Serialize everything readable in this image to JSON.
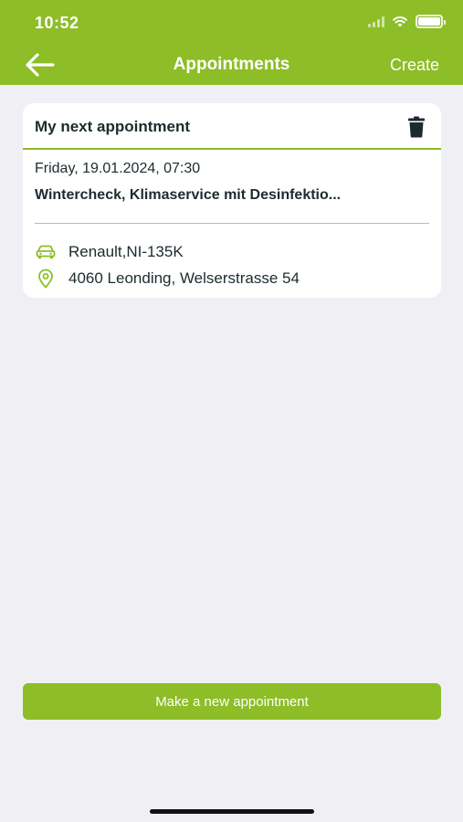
{
  "status_bar": {
    "time": "10:52",
    "icons": [
      "signal-icon",
      "wifi-icon",
      "battery-icon"
    ]
  },
  "header": {
    "back_icon": "arrow-left-icon",
    "title": "Appointments",
    "create_label": "Create"
  },
  "next_appointment": {
    "heading": "My next appointment",
    "delete_icon": "trash-icon",
    "date": "Friday, 19.01.2024, 07:30",
    "service": "Wintercheck, Klimaservice mit Desinfektio...",
    "vehicle": "Renault,NI-135K",
    "location": "4060 Leonding, Welserstrasse 54"
  },
  "actions": {
    "new_appointment_label": "Make a new appointment"
  },
  "colors": {
    "brand_green": "#8dbd27",
    "background": "#f0f0f4",
    "text_dark": "#1d2b2e"
  }
}
